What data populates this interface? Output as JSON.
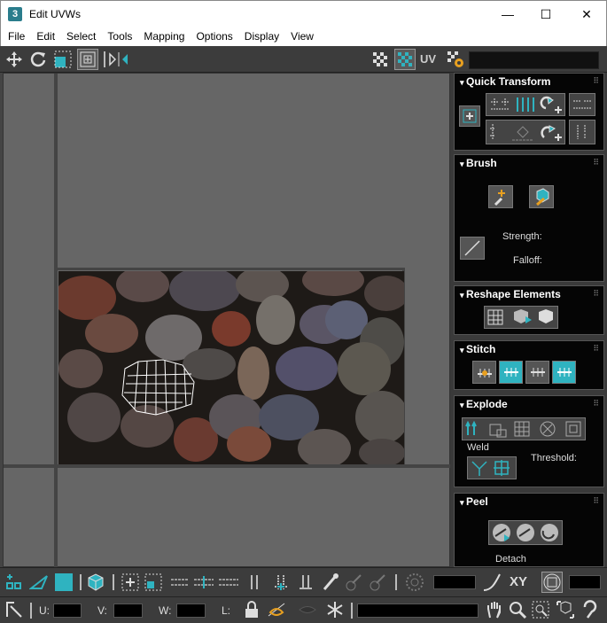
{
  "window": {
    "title": "Edit UVWs",
    "app_icon": "3",
    "min": "—",
    "max": "☐",
    "close": "✕"
  },
  "menu": [
    "File",
    "Edit",
    "Select",
    "Tools",
    "Mapping",
    "Options",
    "Display",
    "View"
  ],
  "toolbar": {
    "uv_label": "UV"
  },
  "panels": {
    "quick_transform": {
      "title": "Quick Transform"
    },
    "brush": {
      "title": "Brush",
      "strength_label": "Strength:",
      "falloff_label": "Falloff:"
    },
    "reshape": {
      "title": "Reshape Elements"
    },
    "stitch": {
      "title": "Stitch"
    },
    "explode": {
      "title": "Explode",
      "weld_label": "Weld",
      "threshold_label": "Threshold:"
    },
    "peel": {
      "title": "Peel",
      "detach_label": "Detach"
    }
  },
  "bottom": {
    "xy_label": "XY",
    "u_label": "U:",
    "v_label": "V:",
    "w_label": "W:",
    "l_label": "L:"
  },
  "colors": {
    "accent": "#2fb3c0",
    "panel_bg": "#050505",
    "viewport_bg": "#666666"
  }
}
